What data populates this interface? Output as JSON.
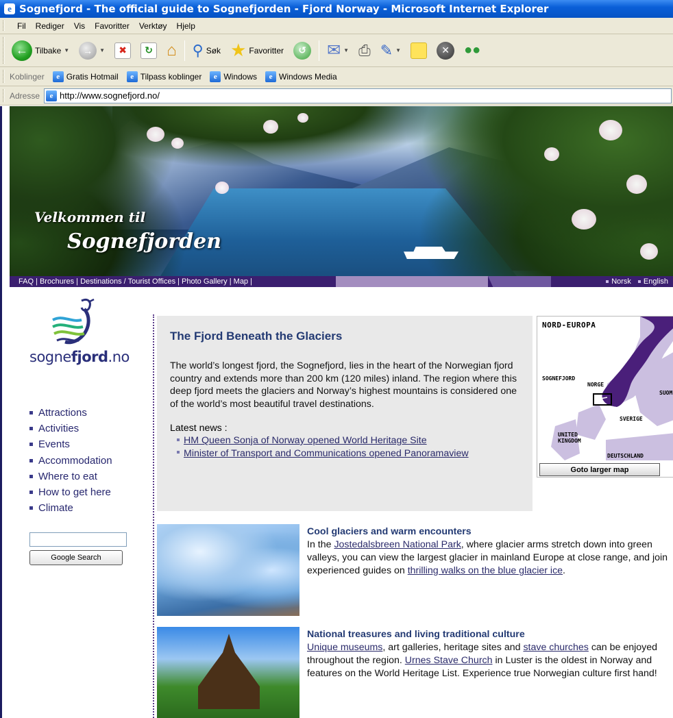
{
  "window": {
    "title": "Sognefjord - The official guide to Sognefjorden - Fjord Norway - Microsoft Internet Explorer"
  },
  "menu": [
    "Fil",
    "Rediger",
    "Vis",
    "Favoritter",
    "Verktøy",
    "Hjelp"
  ],
  "toolbar": {
    "back_label": "Tilbake",
    "search_label": "Søk",
    "favorites_label": "Favoritter"
  },
  "links_bar": {
    "label": "Koblinger",
    "items": [
      "Gratis Hotmail",
      "Tilpass koblinger",
      "Windows",
      "Windows Media"
    ]
  },
  "address_bar": {
    "label": "Adresse",
    "url": "http://www.sognefjord.no/"
  },
  "banner": {
    "welcome_line1": "Velkommen til",
    "welcome_line2": "Sognefjorden"
  },
  "site_nav": {
    "links": "FAQ | Brochures | Destinations / Tourist Offices | Photo Gallery | Map |",
    "lang_norsk": "Norsk",
    "lang_english": "English"
  },
  "sidebar": {
    "logo_text_pre": "sogne",
    "logo_text_bold": "fjord",
    "logo_text_post": ".no",
    "items": [
      "Attractions",
      "Activities",
      "Events",
      "Accommodation",
      "Where to eat",
      "How to get here",
      "Climate"
    ],
    "search_button": "Google Search",
    "search_value": ""
  },
  "intro": {
    "heading": "The Fjord Beneath the Glaciers",
    "body": "The world’s longest fjord, the Sognefjord, lies in the heart of the Norwegian fjord country and extends more than 200 km (120 miles) inland. The region where this deep fjord meets the glaciers and Norway’s highest mountains is considered one of the world’s most beautiful travel destinations.",
    "news_label": "Latest news :",
    "news": [
      "HM Queen Sonja of Norway opened World Heritage Site",
      "Minister of Transport and Communications opened Panoramaview"
    ]
  },
  "map": {
    "title": "NORD-EUROPA",
    "labels": {
      "sognefjord": "SOGNEFJORD",
      "norge": "NORGE",
      "suomi": "SUOM",
      "sverige": "SVERIGE",
      "uk1": "UNITED",
      "uk2": "KINGDOM",
      "deutschland": "DEUTSCHLAND"
    },
    "button": "Goto larger map"
  },
  "features": [
    {
      "title": "Cool glaciers and warm encounters",
      "t1": "In the ",
      "l1": "Jostedalsbreen National Park",
      "t2": ", where glacier arms stretch down into green valleys, you can view the largest glacier in mainland Europe at close range, and join experienced guides on ",
      "l2": "thrilling walks on the blue glacier ice",
      "t3": "."
    },
    {
      "title": "National treasures and living traditional culture",
      "l1": "Unique museums",
      "t1": ", art galleries, heritage sites and ",
      "l2": "stave churches",
      "t2": " can be enjoyed throughout the region. ",
      "l3": "Urnes Stave Church",
      "t3": " in Luster is the oldest in Norway and features on the World Heritage List. Experience true Norwegian culture first hand!"
    }
  ],
  "colors": {
    "nav_purple": "#3b1f6f",
    "heading_blue": "#233a73",
    "link": "#2a2a6a"
  }
}
